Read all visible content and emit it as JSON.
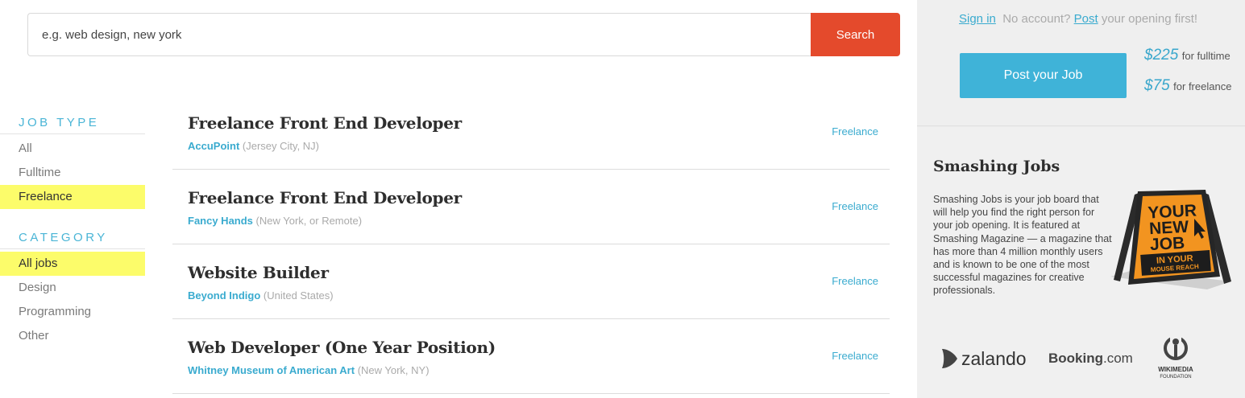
{
  "search": {
    "placeholder": "e.g. web design, new york",
    "button_label": "Search"
  },
  "filters": {
    "job_type": {
      "heading": "JOB TYPE",
      "items": [
        {
          "label": "All"
        },
        {
          "label": "Fulltime"
        },
        {
          "label": "Freelance",
          "active": true
        }
      ]
    },
    "category": {
      "heading": "CATEGORY",
      "items": [
        {
          "label": "All jobs",
          "active": true
        },
        {
          "label": "Design"
        },
        {
          "label": "Programming"
        },
        {
          "label": "Other"
        }
      ]
    }
  },
  "jobs": [
    {
      "title": "Freelance Front End Developer",
      "company": "AccuPoint",
      "location": "(Jersey City, NJ)",
      "type": "Freelance"
    },
    {
      "title": "Freelance Front End Developer",
      "company": "Fancy Hands",
      "location": "(New York, or Remote)",
      "type": "Freelance"
    },
    {
      "title": "Website Builder",
      "company": "Beyond Indigo",
      "location": "(United States)",
      "type": "Freelance"
    },
    {
      "title": "Web Developer (One Year Position)",
      "company": "Whitney Museum of American Art",
      "location": "(New York, NY)",
      "type": "Freelance"
    }
  ],
  "sidebar": {
    "sign_in": "Sign in",
    "no_account": "No account?",
    "post_link": "Post",
    "post_rest": "your opening first!",
    "post_button": "Post your Job",
    "prices": [
      {
        "amount": "$225",
        "label": "for fulltime"
      },
      {
        "amount": "$75",
        "label": "for freelance"
      }
    ],
    "about_title": "Smashing Jobs",
    "about_text": "Smashing Jobs is your job board that will help you find the right person for your job opening. It is featured at Smashing Magazine — a magazine that has more than 4 million monthly users and is known to be one of the most successful magazines for creative professionals.",
    "sign_image": {
      "line1": "YOUR",
      "line2": "NEW",
      "line3": "JOB",
      "line4": "IN YOUR",
      "line5": "MOUSE REACH"
    },
    "logos": {
      "zalando": "zalando",
      "booking_main": "Booking",
      "booking_suffix": ".com",
      "wikimedia_line1": "WIKIMEDIA",
      "wikimedia_line2": "FOUNDATION"
    }
  },
  "colors": {
    "search_button": "#e44a2c",
    "filter_heading": "#4ab5d6",
    "active_highlight": "#fcfc6a",
    "link": "#3aabcf",
    "post_button": "#3fb3d8",
    "price": "#3aa7cc",
    "sign_orange": "#f29420"
  }
}
